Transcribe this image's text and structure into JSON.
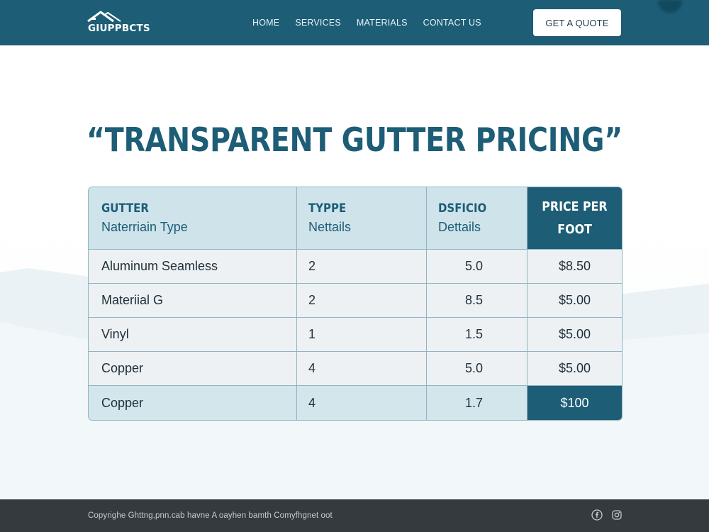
{
  "header": {
    "logo_text": "GIUPPBCTS",
    "nav": [
      "HOME",
      "SERVICES",
      "MATERIALS",
      "CONTACT US"
    ],
    "cta_label": "GET A QUOTE"
  },
  "hero": {
    "headline": "“TRANSPARENT GUTTER PRICING”"
  },
  "table": {
    "columns": [
      {
        "top": "GUTTER",
        "sub": "Naterriain Type"
      },
      {
        "top": "TYPPE",
        "sub": "Nettails"
      },
      {
        "top": "DSFICIO",
        "sub": "Dettails"
      },
      {
        "top": "PRICE PER",
        "bottom": "FOOT"
      }
    ],
    "rows": [
      {
        "material": "Aluminum Seamless",
        "type": "2",
        "details": "5.0",
        "price": "$8.50"
      },
      {
        "material": "Materiial  G",
        "type": "2",
        "details": "8.5",
        "price": "$5.00"
      },
      {
        "material": "Vinyl",
        "type": "1",
        "details": "1.5",
        "price": "$5.00"
      },
      {
        "material": "Copper",
        "type": "4",
        "details": "5.0",
        "price": "$5.00"
      },
      {
        "material": "Copper",
        "type": "4",
        "details": "1.7",
        "price": "$100"
      }
    ]
  },
  "footer": {
    "copyright": "Copyrighe Ghttng,pnn.cab havne A oayhen bamth Comyfhgnet oot",
    "icons": [
      "facebook-icon",
      "instagram-icon"
    ]
  },
  "colors": {
    "brand": "#1d5d76",
    "table_header": "#cfe3ea",
    "table_row": "#eef1f3",
    "footer": "#343a3e"
  }
}
